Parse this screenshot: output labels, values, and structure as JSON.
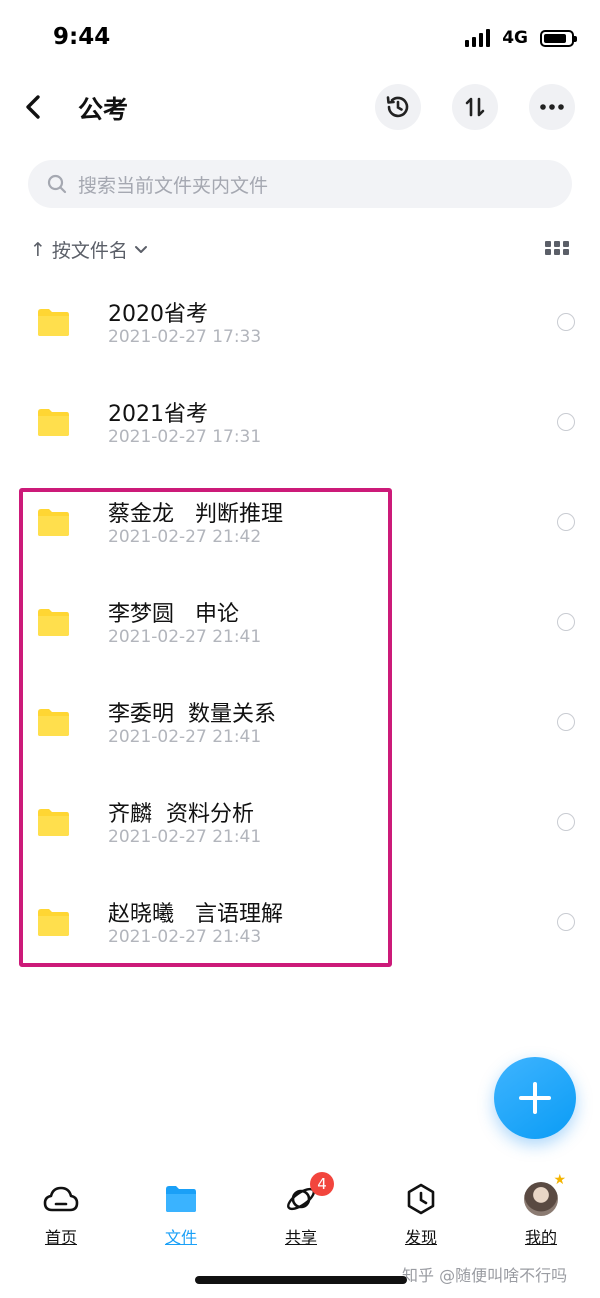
{
  "status": {
    "time": "9:44",
    "network": "4G"
  },
  "nav": {
    "title": "公考",
    "back_icon": "chevron-left-icon",
    "actions": [
      "history-icon",
      "sort-arrows-icon",
      "more-icon"
    ]
  },
  "search": {
    "placeholder": "搜索当前文件夹内文件"
  },
  "sort": {
    "arrow": "↑",
    "label": "按文件名"
  },
  "files": [
    {
      "name": "2020省考",
      "date": "2021-02-27 17:33"
    },
    {
      "name": "2021省考",
      "date": "2021-02-27 17:31"
    },
    {
      "name": "蔡金龙   判断推理",
      "date": "2021-02-27 21:42"
    },
    {
      "name": "李梦圆   申论",
      "date": "2021-02-27 21:41"
    },
    {
      "name": "李委明  数量关系",
      "date": "2021-02-27 21:41"
    },
    {
      "name": "齐麟  资料分析",
      "date": "2021-02-27 21:41"
    },
    {
      "name": "赵晓曦   言语理解",
      "date": "2021-02-27 21:43"
    }
  ],
  "tabs": [
    {
      "label": "首页",
      "icon": "cloud-icon"
    },
    {
      "label": "文件",
      "icon": "folder-icon"
    },
    {
      "label": "共享",
      "icon": "orbit-icon",
      "badge": "4"
    },
    {
      "label": "发现",
      "icon": "compass-icon"
    },
    {
      "label": "我的",
      "icon": "avatar"
    }
  ],
  "watermark": "知乎 @随便叫啥不行吗",
  "colors": {
    "accent": "#1aa0f7",
    "folder": "#ffd633",
    "highlight": "#cc1a79",
    "badge": "#f2453d"
  }
}
